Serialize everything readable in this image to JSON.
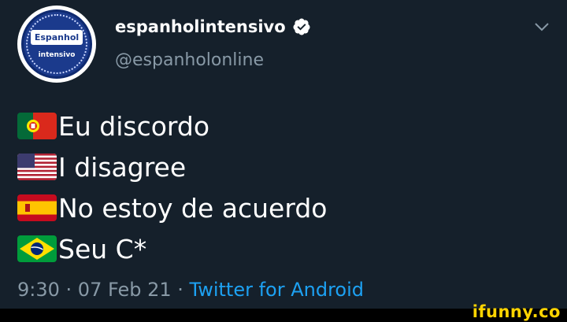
{
  "avatar": {
    "top_text": "Espanhol",
    "bottom_text": "intensivo"
  },
  "user": {
    "display_name": "espanholintensivo",
    "handle": "@espanholonline",
    "verified_icon": "verified-badge-icon"
  },
  "menu_icon": "chevron-down-icon",
  "tweet": {
    "lines": [
      {
        "flag": "portugal-flag-icon",
        "text": "Eu discordo"
      },
      {
        "flag": "usa-flag-icon",
        "text": "I disagree"
      },
      {
        "flag": "spain-flag-icon",
        "text": "No estoy de acuerdo"
      },
      {
        "flag": "brazil-flag-icon",
        "text": "Seu C*"
      }
    ]
  },
  "meta": {
    "time": "9:30",
    "separator": " · ",
    "date": "07 Feb 21",
    "source": "Twitter for Android"
  },
  "watermark": "ifunny.co",
  "colors": {
    "background": "#15202b",
    "secondary_text": "#8899a6",
    "link": "#1da1f2",
    "watermark": "#ffd400"
  }
}
